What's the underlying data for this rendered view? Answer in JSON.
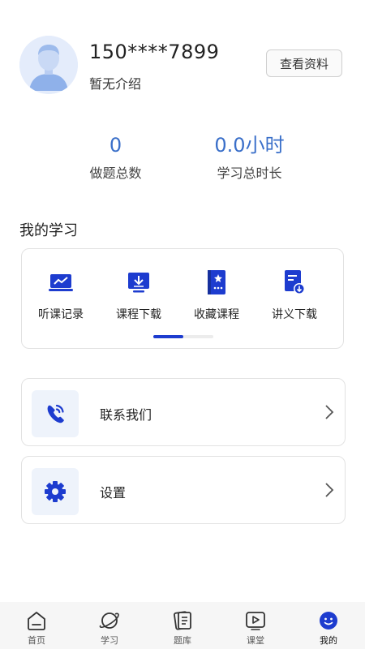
{
  "profile": {
    "phone": "150****7899",
    "intro": "暂无介绍",
    "view_button": "查看资料"
  },
  "stats": [
    {
      "value": "0",
      "label": "做题总数"
    },
    {
      "value": "0.0小时",
      "label": "学习总时长"
    }
  ],
  "my_study": {
    "title": "我的学习",
    "items": [
      {
        "label": "听课记录",
        "icon": "chart-screen-icon"
      },
      {
        "label": "课程下载",
        "icon": "download-screen-icon"
      },
      {
        "label": "收藏课程",
        "icon": "bookmark-book-icon"
      },
      {
        "label": "讲义下载",
        "icon": "document-download-icon"
      }
    ],
    "scroll_position": 0.5
  },
  "menu": [
    {
      "label": "联系我们",
      "icon": "phone-icon"
    },
    {
      "label": "设置",
      "icon": "gear-icon"
    }
  ],
  "tabbar": {
    "items": [
      {
        "label": "首页",
        "icon": "home-icon"
      },
      {
        "label": "学习",
        "icon": "planet-icon"
      },
      {
        "label": "题库",
        "icon": "notebook-icon"
      },
      {
        "label": "课堂",
        "icon": "video-play-icon"
      },
      {
        "label": "我的",
        "icon": "user-face-icon"
      }
    ],
    "active": "我的"
  },
  "colors": {
    "accent": "#3a6fc9",
    "icon_blue": "#1d3ccf",
    "card_border": "#e2e2e2"
  }
}
